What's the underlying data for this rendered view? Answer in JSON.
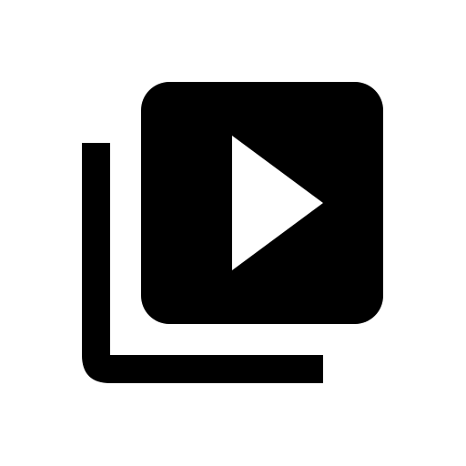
{
  "icon": {
    "name": "video-library-icon",
    "parts": [
      "back-stack-frame",
      "front-video-tile",
      "play-triangle"
    ]
  },
  "colors": {
    "background": "#ffffff",
    "foreground": "#000000",
    "accent": "#ffffff"
  }
}
